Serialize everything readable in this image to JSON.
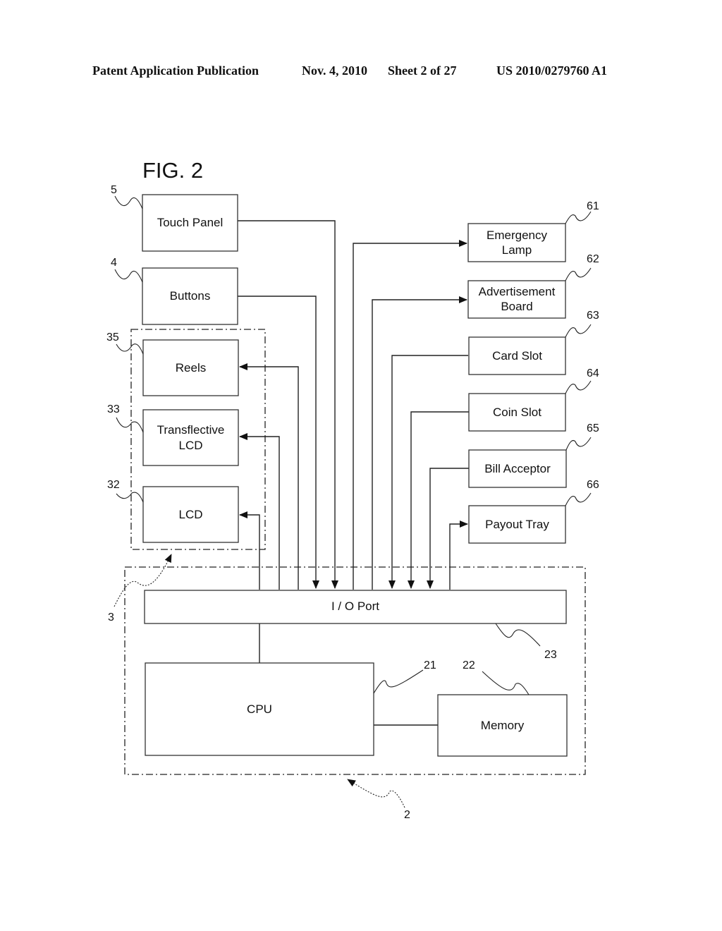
{
  "header": {
    "publication": "Patent Application Publication",
    "date": "Nov. 4, 2010",
    "sheet": "Sheet 2 of 27",
    "number": "US 2010/0279760 A1"
  },
  "figure": {
    "title": "FIG. 2"
  },
  "blocks": {
    "touch_panel": {
      "label": "Touch Panel",
      "ref": "5"
    },
    "buttons": {
      "label": "Buttons",
      "ref": "4"
    },
    "reels": {
      "label": "Reels",
      "ref": "35"
    },
    "transflective_lcd": {
      "label_line1": "Transflective",
      "label_line2": "LCD",
      "ref": "33"
    },
    "lcd": {
      "label": "LCD",
      "ref": "32"
    },
    "emergency_lamp": {
      "label_line1": "Emergency",
      "label_line2": "Lamp",
      "ref": "61"
    },
    "advertisement_board": {
      "label_line1": "Advertisement",
      "label_line2": "Board",
      "ref": "62"
    },
    "card_slot": {
      "label": "Card Slot",
      "ref": "63"
    },
    "coin_slot": {
      "label": "Coin Slot",
      "ref": "64"
    },
    "bill_acceptor": {
      "label": "Bill Acceptor",
      "ref": "65"
    },
    "payout_tray": {
      "label": "Payout Tray",
      "ref": "66"
    },
    "io_port": {
      "label": "I / O Port",
      "ref": "23"
    },
    "cpu": {
      "label": "CPU",
      "ref": "21"
    },
    "memory": {
      "label": "Memory",
      "ref": "22"
    }
  },
  "groups": {
    "display_group": {
      "ref": "3"
    },
    "main_board": {
      "ref": "2"
    }
  }
}
